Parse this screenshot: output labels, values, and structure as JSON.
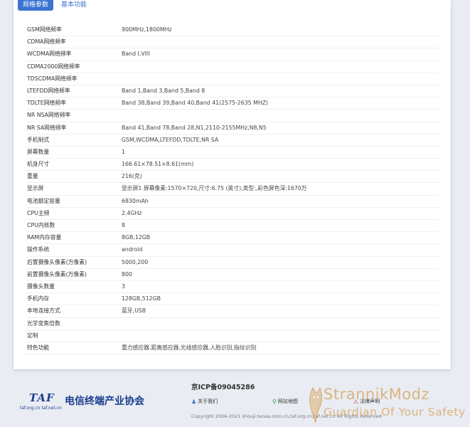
{
  "tabs": [
    {
      "label": "规格参数",
      "active": true
    },
    {
      "label": "基本功能",
      "active": false
    }
  ],
  "specs": [
    {
      "key": "GSM网络频率",
      "value": "900MHz,1800MHz"
    },
    {
      "key": "CDMA网络频率",
      "value": ""
    },
    {
      "key": "WCDMA网络频率",
      "value": "Band I,VIII"
    },
    {
      "key": "CDMA2000网络频率",
      "value": ""
    },
    {
      "key": "TDSCDMA网络频率",
      "value": ""
    },
    {
      "key": "LTEFDD网络频率",
      "value": "Band 1,Band 3,Band 5,Band 8"
    },
    {
      "key": "TDLTE网络频率",
      "value": "Band 38,Band 39,Band 40,Band 41(2575-2635 MHZ)"
    },
    {
      "key": "NR NSA网络频率",
      "value": ""
    },
    {
      "key": "NR SA网络频率",
      "value": "Band 41,Band 78,Band 28,N1,2110-2155MHz,N8,N5"
    },
    {
      "key": "手机制式",
      "value": "GSM,WCDMA,LTEFDD,TDLTE,NR SA"
    },
    {
      "key": "屏幕数量",
      "value": "1"
    },
    {
      "key": "机身尺寸",
      "value": "166.61×78.51×8.61(mm)"
    },
    {
      "key": "重量",
      "value": "216(克)"
    },
    {
      "key": "显示屏",
      "value": "显示屏1 屏幕像素:1570×720,尺寸:6.75 (英寸),类型:,彩色屏色深:1670万"
    },
    {
      "key": "电池额定容量",
      "value": "6830mAh"
    },
    {
      "key": "CPU主频",
      "value": "2.4GHz"
    },
    {
      "key": "CPU内核数",
      "value": "8"
    },
    {
      "key": "RAM内存容量",
      "value": "8GB,12GB"
    },
    {
      "key": "操作系统",
      "value": "android"
    },
    {
      "key": "后置摄像头像素(万像素)",
      "value": "5000,200"
    },
    {
      "key": "前置摄像头像素(万像素)",
      "value": "800"
    },
    {
      "key": "摄像头数量",
      "value": "3"
    },
    {
      "key": "手机内存",
      "value": "128GB,512GB"
    },
    {
      "key": "本地连接方式",
      "value": "蓝牙,USB"
    },
    {
      "key": "光学变焦倍数",
      "value": ""
    },
    {
      "key": "定制",
      "value": ""
    },
    {
      "key": "特色功能",
      "value": "重力感应器,距离感应器,光线感应器,人脸识别,指纹识别"
    }
  ],
  "footer": {
    "logo_mark": "TAF",
    "logo_name": "电信终端产业协会",
    "logo_urls": "taf.org.cn   taf.net.cn",
    "icp": "京ICP备09045286",
    "links": [
      {
        "icon": "people-icon",
        "label": "关于我们"
      },
      {
        "icon": "location-icon",
        "label": "网站地图"
      },
      {
        "icon": "legal-icon",
        "label": "法律声明"
      }
    ],
    "copyright": "Copyright 2006-2021 shouji.tenaa.com.cn,taf.org.cn,taf.net.cn All Rights Reserved"
  },
  "watermark": {
    "title": "StrannikModz",
    "subtitle": "Guardian Of Your Safety"
  }
}
